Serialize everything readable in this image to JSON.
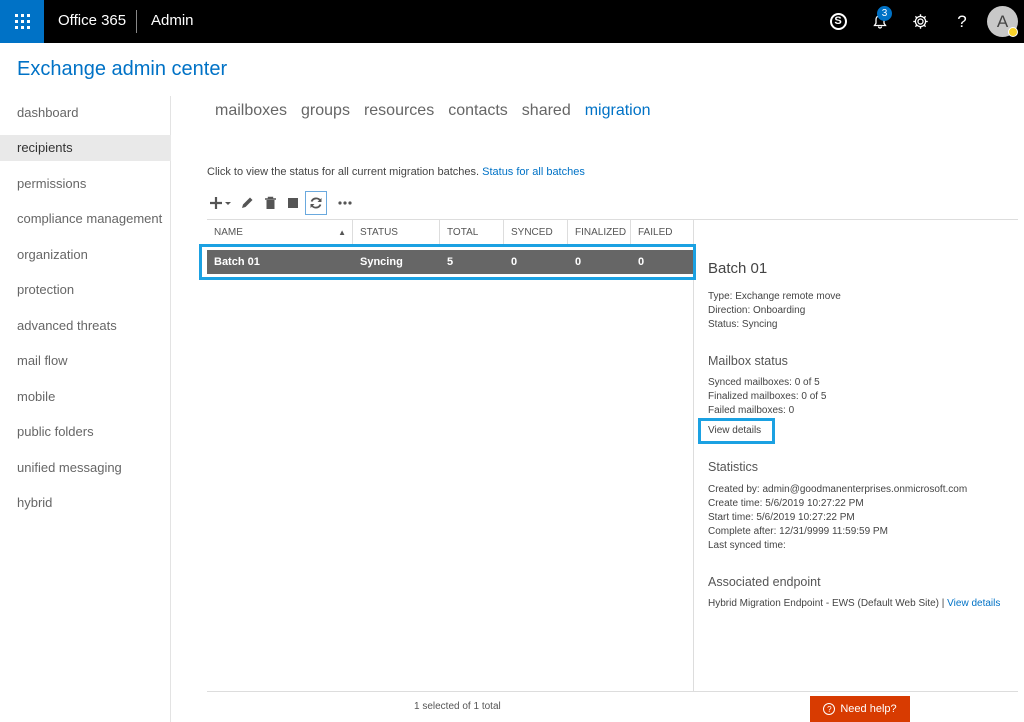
{
  "topbar": {
    "brand": "Office 365",
    "app": "Admin",
    "notification_count": "3",
    "avatar_initial": "A",
    "skype_glyph": "S",
    "help_glyph": "?",
    "icons": [
      "app-launcher-icon",
      "skype-icon",
      "bell-icon",
      "gear-icon",
      "help-icon"
    ]
  },
  "page_title": "Exchange admin center",
  "sidebar": {
    "items": [
      {
        "label": "dashboard"
      },
      {
        "label": "recipients"
      },
      {
        "label": "permissions"
      },
      {
        "label": "compliance management"
      },
      {
        "label": "organization"
      },
      {
        "label": "protection"
      },
      {
        "label": "advanced threats"
      },
      {
        "label": "mail flow"
      },
      {
        "label": "mobile"
      },
      {
        "label": "public folders"
      },
      {
        "label": "unified messaging"
      },
      {
        "label": "hybrid"
      }
    ],
    "active": "recipients"
  },
  "tabs": [
    {
      "label": "mailboxes"
    },
    {
      "label": "groups"
    },
    {
      "label": "resources"
    },
    {
      "label": "contacts"
    },
    {
      "label": "shared"
    },
    {
      "label": "migration"
    }
  ],
  "active_tab": "migration",
  "info": {
    "text": "Click to view the status for all current migration batches.",
    "link": "Status for all batches"
  },
  "toolbar": [
    "add-icon",
    "edit-icon",
    "delete-icon",
    "stop-icon",
    "refresh-icon",
    "more-icon"
  ],
  "table": {
    "columns": [
      "NAME",
      "STATUS",
      "TOTAL",
      "SYNCED",
      "FINALIZED",
      "FAILED"
    ],
    "rows": [
      {
        "name": "Batch 01",
        "status": "Syncing",
        "total": "5",
        "synced": "0",
        "finalized": "0",
        "failed": "0"
      }
    ],
    "footer": "1 selected of 1 total"
  },
  "details": {
    "title": "Batch 01",
    "type": "Type: Exchange remote move",
    "direction": "Direction: Onboarding",
    "status": "Status: Syncing",
    "mailbox_status_heading": "Mailbox status",
    "synced": "Synced mailboxes: 0 of 5",
    "finalized": "Finalized mailboxes: 0 of 5",
    "failed": "Failed mailboxes: 0",
    "view_details": "View details",
    "statistics_heading": "Statistics",
    "created_by": "Created by: admin@goodmanenterprises.onmicrosoft.com",
    "create_time": "Create time: 5/6/2019 10:27:22 PM",
    "start_time": "Start time: 5/6/2019 10:27:22 PM",
    "complete_after": "Complete after: 12/31/9999 11:59:59 PM",
    "last_synced": "Last synced time:",
    "endpoint_heading": "Associated endpoint",
    "endpoint_text": "Hybrid Migration Endpoint - EWS (Default Web Site)",
    "endpoint_sep": " | ",
    "endpoint_link": "View details"
  },
  "need_help": "Need help?",
  "colors": {
    "accent": "#0072c6",
    "highlight": "#1ba1e2",
    "selected_row": "#666666",
    "help_button": "#d83b01"
  }
}
